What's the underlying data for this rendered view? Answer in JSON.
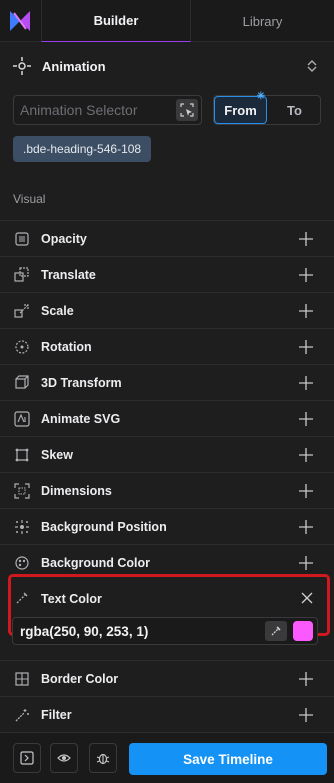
{
  "tabs": {
    "builder": "Builder",
    "library": "Library"
  },
  "section": {
    "title": "Animation"
  },
  "selector": {
    "placeholder": "Animation Selector"
  },
  "toggle": {
    "from": "From",
    "to": "To",
    "active": "From"
  },
  "chip": {
    "label": ".bde-heading-546-108"
  },
  "group_label": "Visual",
  "properties": [
    {
      "label": "Opacity",
      "icon": "opacity-icon"
    },
    {
      "label": "Translate",
      "icon": "translate-icon"
    },
    {
      "label": "Scale",
      "icon": "scale-icon"
    },
    {
      "label": "Rotation",
      "icon": "rotation-icon"
    },
    {
      "label": "3D Transform",
      "icon": "3d-transform-icon"
    },
    {
      "label": "Animate SVG",
      "icon": "animate-svg-icon"
    },
    {
      "label": "Skew",
      "icon": "skew-icon"
    },
    {
      "label": "Dimensions",
      "icon": "dimensions-icon"
    },
    {
      "label": "Background Position",
      "icon": "background-position-icon"
    },
    {
      "label": "Background Color",
      "icon": "background-color-icon"
    }
  ],
  "text_color": {
    "label": "Text Color",
    "value": "rgba(250, 90, 253, 1)",
    "swatch": "#fa5afd"
  },
  "properties_after": [
    {
      "label": "Border Color",
      "icon": "border-color-icon"
    },
    {
      "label": "Filter",
      "icon": "filter-icon"
    }
  ],
  "footer": {
    "save_label": "Save Timeline"
  },
  "colors": {
    "accent": "#1592f5",
    "highlight": "#d0191e",
    "tab_indicator": "#9d3cf0"
  }
}
